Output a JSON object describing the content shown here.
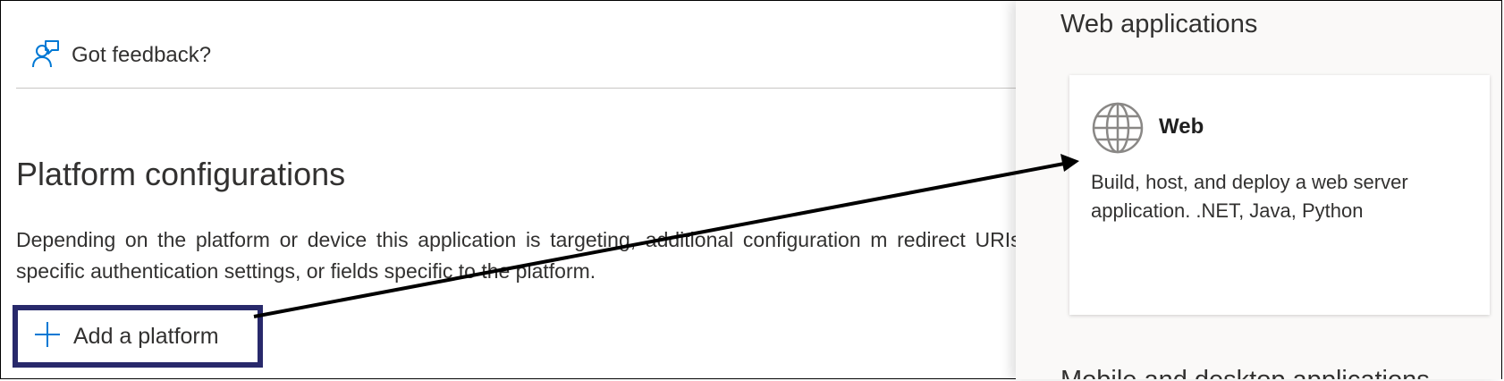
{
  "feedback": {
    "icon": "feedback-person-icon",
    "label": "Got feedback?"
  },
  "main": {
    "title": "Platform configurations",
    "description": "Depending on the platform or device this application is targeting, additional configuration m redirect URIs, specific authentication settings, or fields specific to the platform.",
    "add_platform": {
      "icon": "plus-icon",
      "label": "Add a platform",
      "highlight_color": "#28296b"
    }
  },
  "panel": {
    "heading": "Web applications",
    "card": {
      "icon": "globe-icon",
      "title": "Web",
      "description": "Build, host, and deploy a web server application. .NET, Java, Python"
    },
    "next_heading": "Mobile and desktop applications"
  },
  "colors": {
    "accent": "#0078d4",
    "annotation_box": "#28296b",
    "arrow": "#000000"
  }
}
